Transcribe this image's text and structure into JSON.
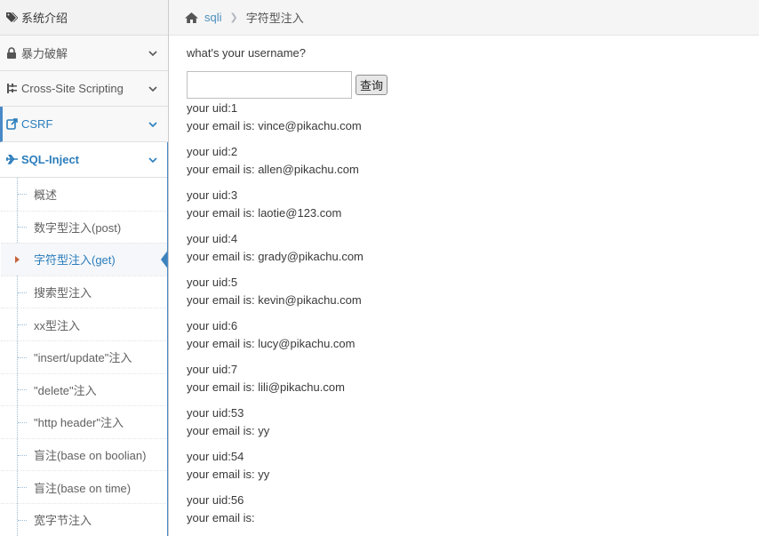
{
  "sidebar": {
    "top": {
      "icon": "tags-icon",
      "label": "系统介绍"
    },
    "groups": [
      {
        "icon": "lock-icon",
        "label": "暴力破解"
      },
      {
        "icon": "sitemap-icon",
        "label": "Cross-Site Scripting"
      },
      {
        "icon": "share-icon",
        "label": "CSRF"
      },
      {
        "icon": "plane-icon",
        "label": "SQL-Inject"
      }
    ],
    "sqli_items": [
      "概述",
      "数字型注入(post)",
      "字符型注入(get)",
      "搜索型注入",
      "xx型注入",
      "\"insert/update\"注入",
      "\"delete\"注入",
      "\"http header\"注入",
      "盲注(base on boolian)",
      "盲注(base on time)",
      "宽字节注入"
    ],
    "active_item": "字符型注入(get)"
  },
  "breadcrumb": {
    "home_icon": "home-icon",
    "link": "sqli",
    "current": "字符型注入"
  },
  "form": {
    "question": "what's your username?",
    "input_value": "",
    "submit_label": "查询"
  },
  "results": [
    {
      "uid": "your uid:1",
      "email": "your email is: vince@pikachu.com"
    },
    {
      "uid": "your uid:2",
      "email": "your email is: allen@pikachu.com"
    },
    {
      "uid": "your uid:3",
      "email": "your email is: laotie@123.com"
    },
    {
      "uid": "your uid:4",
      "email": "your email is: grady@pikachu.com"
    },
    {
      "uid": "your uid:5",
      "email": "your email is: kevin@pikachu.com"
    },
    {
      "uid": "your uid:6",
      "email": "your email is: lucy@pikachu.com"
    },
    {
      "uid": "your uid:7",
      "email": "your email is: lili@pikachu.com"
    },
    {
      "uid": "your uid:53",
      "email": "your email is: yy"
    },
    {
      "uid": "your uid:54",
      "email": "your email is: yy"
    },
    {
      "uid": "your uid:56",
      "email": "your email is:"
    }
  ],
  "colors": {
    "accent": "#2b7dbc",
    "link": "#4c8fbd",
    "active_caret": "#c86139"
  }
}
